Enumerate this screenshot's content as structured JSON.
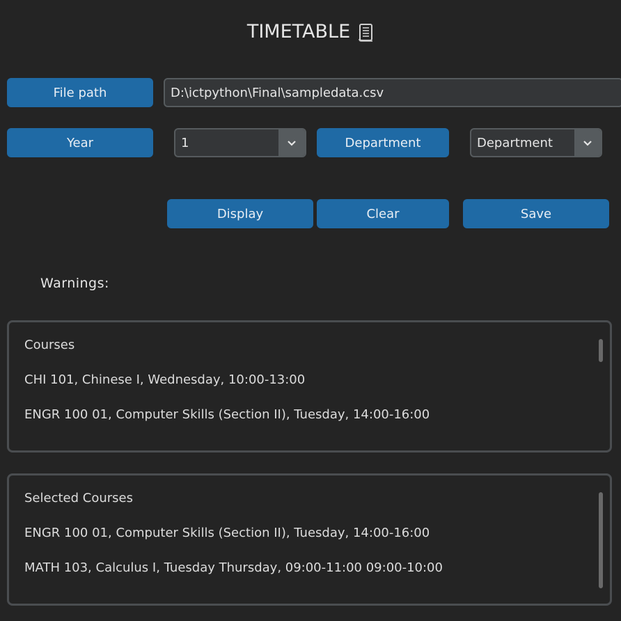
{
  "header": {
    "title": "TIMETABLE",
    "title_icon": "scroll-icon"
  },
  "file": {
    "label": "File path",
    "value": "D:\\ictpython\\Final\\sampledata.csv"
  },
  "year": {
    "label": "Year",
    "selected": "1"
  },
  "department": {
    "label": "Department",
    "selected": "Department"
  },
  "actions": {
    "display_label": "Display",
    "clear_label": "Clear",
    "save_label": "Save"
  },
  "warnings": {
    "label": "Warnings:"
  },
  "courses": {
    "header": "Courses",
    "items": [
      "CHI 101, Chinese I, Wednesday, 10:00-13:00",
      "ENGR 100 01, Computer Skills (Section II), Tuesday, 14:00-16:00"
    ]
  },
  "selected_courses": {
    "header": "Selected Courses",
    "items": [
      "ENGR 100 01, Computer Skills (Section II), Tuesday, 14:00-16:00",
      "MATH 103, Calculus I, Tuesday Thursday, 09:00-11:00 09:00-10:00"
    ]
  },
  "colors": {
    "background": "#242424",
    "button": "#1f6aa5",
    "entry": "#343638",
    "border": "#565b5e"
  }
}
